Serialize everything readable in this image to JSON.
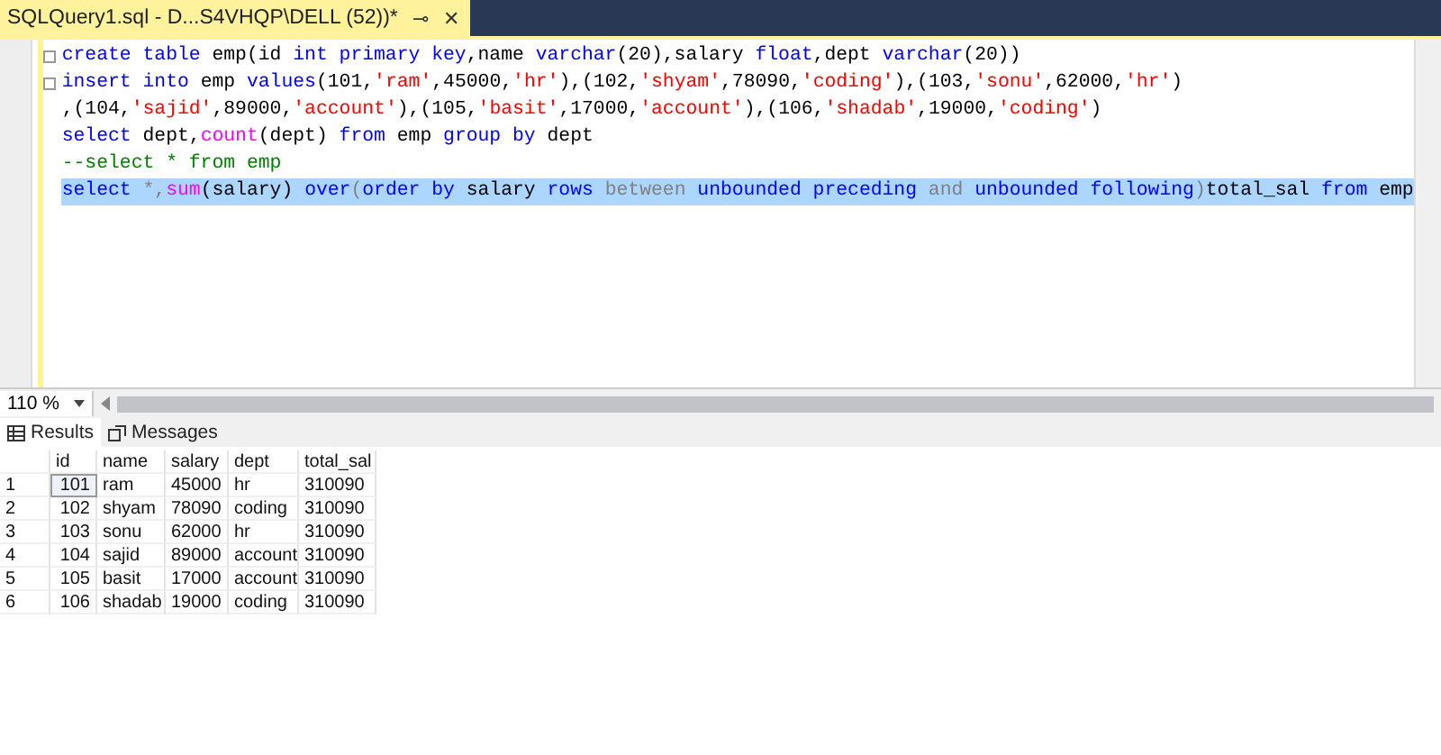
{
  "document_tab": {
    "title": "SQLQuery1.sql - D...S4VHQP\\DELL (52))*",
    "pin": "⊸",
    "close": "✕"
  },
  "editor": {
    "lines": [
      {
        "fold_marker": true,
        "selected": false,
        "tokens": [
          {
            "kind": "kw",
            "text": "create table"
          },
          {
            "kind": "plain",
            "text": " emp(id "
          },
          {
            "kind": "kw",
            "text": "int primary key"
          },
          {
            "kind": "plain",
            "text": ",name "
          },
          {
            "kind": "kw",
            "text": "varchar"
          },
          {
            "kind": "plain",
            "text": "(20),salary "
          },
          {
            "kind": "kw",
            "text": "float"
          },
          {
            "kind": "plain",
            "text": ",dept "
          },
          {
            "kind": "kw",
            "text": "varchar"
          },
          {
            "kind": "plain",
            "text": "(20))"
          }
        ]
      },
      {
        "fold_marker": true,
        "selected": false,
        "tokens": [
          {
            "kind": "kw",
            "text": "insert into"
          },
          {
            "kind": "plain",
            "text": " emp "
          },
          {
            "kind": "kw",
            "text": "values"
          },
          {
            "kind": "plain",
            "text": "(101,"
          },
          {
            "kind": "str",
            "text": "'ram'"
          },
          {
            "kind": "plain",
            "text": ",45000,"
          },
          {
            "kind": "str",
            "text": "'hr'"
          },
          {
            "kind": "plain",
            "text": "),(102,"
          },
          {
            "kind": "str",
            "text": "'shyam'"
          },
          {
            "kind": "plain",
            "text": ",78090,"
          },
          {
            "kind": "str",
            "text": "'coding'"
          },
          {
            "kind": "plain",
            "text": "),(103,"
          },
          {
            "kind": "str",
            "text": "'sonu'"
          },
          {
            "kind": "plain",
            "text": ",62000,"
          },
          {
            "kind": "str",
            "text": "'hr'"
          },
          {
            "kind": "plain",
            "text": ")"
          }
        ]
      },
      {
        "fold_marker": false,
        "selected": false,
        "tokens": [
          {
            "kind": "plain",
            "text": ",(104,"
          },
          {
            "kind": "str",
            "text": "'sajid'"
          },
          {
            "kind": "plain",
            "text": ",89000,"
          },
          {
            "kind": "str",
            "text": "'account'"
          },
          {
            "kind": "plain",
            "text": "),(105,"
          },
          {
            "kind": "str",
            "text": "'basit'"
          },
          {
            "kind": "plain",
            "text": ",17000,"
          },
          {
            "kind": "str",
            "text": "'account'"
          },
          {
            "kind": "plain",
            "text": "),(106,"
          },
          {
            "kind": "str",
            "text": "'shadab'"
          },
          {
            "kind": "plain",
            "text": ",19000,"
          },
          {
            "kind": "str",
            "text": "'coding'"
          },
          {
            "kind": "plain",
            "text": ")"
          }
        ]
      },
      {
        "fold_marker": false,
        "selected": false,
        "tokens": [
          {
            "kind": "kw",
            "text": "select"
          },
          {
            "kind": "plain",
            "text": " dept,"
          },
          {
            "kind": "fn",
            "text": "count"
          },
          {
            "kind": "plain",
            "text": "(dept) "
          },
          {
            "kind": "kw",
            "text": "from"
          },
          {
            "kind": "plain",
            "text": " emp "
          },
          {
            "kind": "kw",
            "text": "group by"
          },
          {
            "kind": "plain",
            "text": " dept"
          }
        ]
      },
      {
        "fold_marker": false,
        "selected": false,
        "tokens": [
          {
            "kind": "cm",
            "text": "--select * from emp"
          }
        ]
      },
      {
        "fold_marker": false,
        "selected": true,
        "tokens": [
          {
            "kind": "kw",
            "text": "select"
          },
          {
            "kind": "op",
            "text": " *,"
          },
          {
            "kind": "fn",
            "text": "sum"
          },
          {
            "kind": "plain",
            "text": "(salary) "
          },
          {
            "kind": "kw",
            "text": "over"
          },
          {
            "kind": "op",
            "text": "("
          },
          {
            "kind": "kw",
            "text": "order by"
          },
          {
            "kind": "plain",
            "text": " salary "
          },
          {
            "kind": "kw",
            "text": "rows"
          },
          {
            "kind": "op",
            "text": " between "
          },
          {
            "kind": "kw",
            "text": "unbounded preceding"
          },
          {
            "kind": "op",
            "text": " and "
          },
          {
            "kind": "kw",
            "text": "unbounded following"
          },
          {
            "kind": "op",
            "text": ")"
          },
          {
            "kind": "plain",
            "text": "total_sal "
          },
          {
            "kind": "kw",
            "text": "from"
          },
          {
            "kind": "plain",
            "text": " emp"
          }
        ]
      }
    ]
  },
  "zoom": {
    "value": "110 %"
  },
  "result_tabs": [
    {
      "label": "Results",
      "selected": true
    },
    {
      "label": "Messages",
      "selected": false
    }
  ],
  "table": {
    "columns": [
      "id",
      "name",
      "salary",
      "dept",
      "total_sal"
    ],
    "rows": [
      {
        "number": "1",
        "focused": true,
        "cells": [
          "101",
          "ram",
          "45000",
          "hr",
          "310090"
        ]
      },
      {
        "number": "2",
        "focused": false,
        "cells": [
          "102",
          "shyam",
          "78090",
          "coding",
          "310090"
        ]
      },
      {
        "number": "3",
        "focused": false,
        "cells": [
          "103",
          "sonu",
          "62000",
          "hr",
          "310090"
        ]
      },
      {
        "number": "4",
        "focused": false,
        "cells": [
          "104",
          "sajid",
          "89000",
          "account",
          "310090"
        ]
      },
      {
        "number": "5",
        "focused": false,
        "cells": [
          "105",
          "basit",
          "17000",
          "account",
          "310090"
        ]
      },
      {
        "number": "6",
        "focused": false,
        "cells": [
          "106",
          "shadab",
          "19000",
          "coding",
          "310090"
        ]
      }
    ]
  }
}
